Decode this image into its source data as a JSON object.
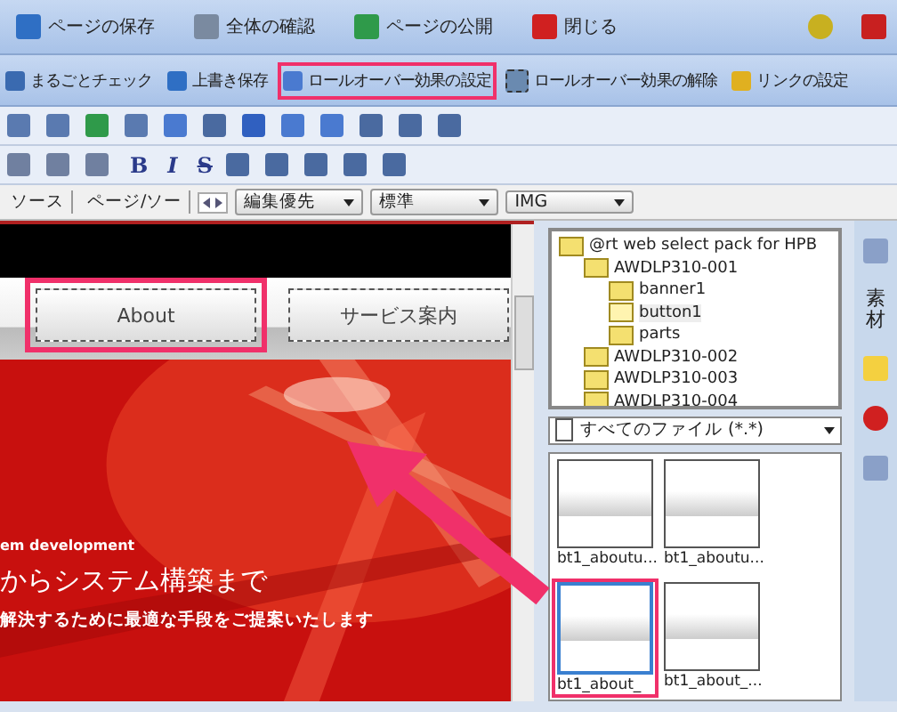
{
  "main_toolbar": [
    {
      "label": "ページの保存"
    },
    {
      "label": "全体の確認"
    },
    {
      "label": "ページの公開"
    },
    {
      "label": "閉じる"
    }
  ],
  "action_toolbar": [
    {
      "label": "まるごとチェック",
      "highlighted": false
    },
    {
      "label": "上書き保存",
      "highlighted": false
    },
    {
      "label": "ロールオーバー効果の設定",
      "highlighted": true
    },
    {
      "label": "ロールオーバー効果の解除",
      "highlighted": false
    },
    {
      "label": "リンクの設定",
      "highlighted": false
    }
  ],
  "format_toolbar": [
    "B",
    "I",
    "S"
  ],
  "view_tabs": [
    "ソース",
    "ページ/ソー"
  ],
  "dropdowns": [
    "編集優先",
    "標準",
    "IMG"
  ],
  "page_nav": [
    {
      "label": "About",
      "selected": true
    },
    {
      "label": "サービス案内",
      "selected": false
    }
  ],
  "hero_lines": [
    "em development",
    "からシステム構築まで",
    "解決するために最適な手段をご提案いたします"
  ],
  "folder_tree": [
    {
      "label": "@rt web select pack for HPB",
      "selected": false,
      "children": [
        {
          "label": "AWDLP310-001",
          "selected": false,
          "children": [
            {
              "label": "banner1",
              "selected": false
            },
            {
              "label": "button1",
              "selected": true
            },
            {
              "label": "parts",
              "selected": false
            }
          ]
        },
        {
          "label": "AWDLP310-002",
          "selected": false
        },
        {
          "label": "AWDLP310-003",
          "selected": false
        },
        {
          "label": "AWDLP310-004",
          "selected": false
        }
      ]
    }
  ],
  "file_filter": "すべてのファイル (*.*)",
  "thumbnails": [
    {
      "caption": "bt1_aboutu...",
      "selected": false
    },
    {
      "caption": "bt1_aboutu...",
      "selected": false
    },
    {
      "caption": "bt1_about_",
      "selected": true
    },
    {
      "caption": "bt1_about_...",
      "selected": false
    }
  ],
  "side_tab": "素材"
}
